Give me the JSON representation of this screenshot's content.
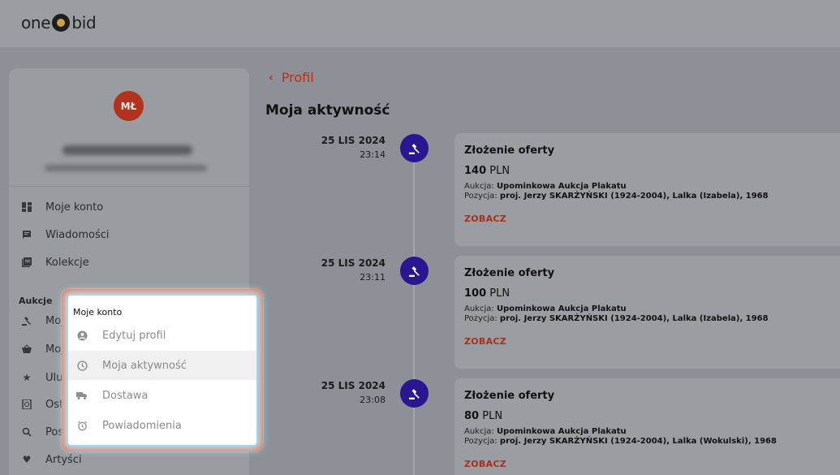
{
  "header": {
    "logo_left": "one",
    "logo_right": "bid"
  },
  "profile": {
    "initials": "MŁ"
  },
  "sidebar": {
    "items": [
      {
        "label": "Moje konto",
        "icon": "dashboard-icon"
      },
      {
        "label": "Wiadomości",
        "icon": "message-icon"
      },
      {
        "label": "Kolekcje",
        "icon": "collection-icon"
      }
    ],
    "section_label": "Aukcje",
    "auction_items": [
      {
        "label": "Moj",
        "icon": "gavel-icon"
      },
      {
        "label": "Moj",
        "icon": "basket-icon"
      },
      {
        "label": "Ulul",
        "icon": "star-icon"
      },
      {
        "label": "Ost",
        "icon": "recent-icon"
      },
      {
        "label": "Pos",
        "icon": "search-icon"
      },
      {
        "label": "Artyści",
        "icon": "heart-icon"
      }
    ]
  },
  "back_link": {
    "label": "Profil"
  },
  "page_title": "Moja aktywność",
  "activities": [
    {
      "date": "25 LIS 2024",
      "time": "23:14",
      "title": "Złożenie oferty",
      "amount": "140",
      "currency": "PLN",
      "auction_label": "Aukcja:",
      "auction": "Upominkowa Aukcja Plakatu",
      "position_label": "Pozycja:",
      "position": "proj. Jerzy SKARŻYŃSKI (1924-2004), Lalka (Izabela), 1968",
      "link": "ZOBACZ"
    },
    {
      "date": "25 LIS 2024",
      "time": "23:11",
      "title": "Złożenie oferty",
      "amount": "100",
      "currency": "PLN",
      "auction_label": "Aukcja:",
      "auction": "Upominkowa Aukcja Plakatu",
      "position_label": "Pozycja:",
      "position": "proj. Jerzy SKARŻYŃSKI (1924-2004), Lalka (Izabela), 1968",
      "link": "ZOBACZ"
    },
    {
      "date": "25 LIS 2024",
      "time": "23:08",
      "title": "Złożenie oferty",
      "amount": "80",
      "currency": "PLN",
      "auction_label": "Aukcja:",
      "auction": "Upominkowa Aukcja Plakatu",
      "position_label": "Pozycja:",
      "position": "proj. Jerzy SKARŻYŃSKI (1924-2004), Lalka (Wokulski), 1968",
      "link": "ZOBACZ"
    }
  ],
  "popup": {
    "title": "Moje konto",
    "items": [
      {
        "label": "Edytuj profil",
        "icon": "user-circle-icon",
        "active": false
      },
      {
        "label": "Moja aktywność",
        "icon": "clock-icon",
        "active": true
      },
      {
        "label": "Dostawa",
        "icon": "truck-icon",
        "active": false
      },
      {
        "label": "Powiadomienia",
        "icon": "alarm-icon",
        "active": false
      }
    ]
  },
  "colors": {
    "accent": "#b3331b",
    "timeline_dot": "#2a1690",
    "highlight_border": "#ee6f3f"
  }
}
